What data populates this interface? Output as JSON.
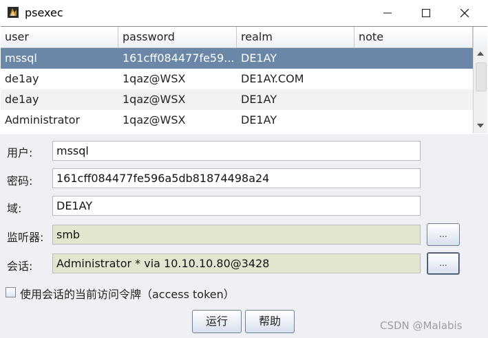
{
  "window": {
    "title": "psexec"
  },
  "table": {
    "headers": [
      "user",
      "password",
      "realm",
      "note"
    ],
    "rows": [
      {
        "user": "mssql",
        "password": "161cff084477fe59...",
        "realm": "DE1AY",
        "note": ""
      },
      {
        "user": "de1ay",
        "password": "1qaz@WSX",
        "realm": "DE1AY.COM",
        "note": ""
      },
      {
        "user": "de1ay",
        "password": "1qaz@WSX",
        "realm": "DE1AY",
        "note": ""
      },
      {
        "user": "Administrator",
        "password": "1qaz@WSX",
        "realm": "DE1AY",
        "note": ""
      }
    ]
  },
  "form": {
    "user_label": "用户:",
    "user_value": "mssql",
    "password_label": "密码:",
    "password_value": "161cff084477fe596a5db81874498a24",
    "domain_label": "域:",
    "domain_value": "DE1AY",
    "listener_label": "监听器:",
    "listener_value": "smb",
    "session_label": "会话:",
    "session_value": "Administrator * via  10.10.10.80@3428",
    "browse_label": "...",
    "token_checkbox_label": "使用会话的当前访问令牌（access token）",
    "run_label": "运行",
    "help_label": "帮助"
  },
  "watermark": "CSDN @Malabis",
  "colors": {
    "selected_row": "#6a87a8",
    "readonly_field": "#e3e6cf",
    "form_bg": "#eef0f4"
  }
}
